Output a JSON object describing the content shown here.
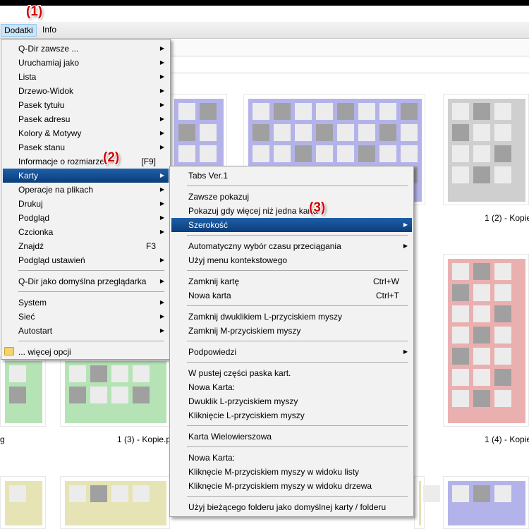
{
  "menubar": {
    "items": [
      {
        "label": "Dodatki",
        "active": true
      },
      {
        "label": "Info",
        "active": false
      }
    ]
  },
  "callouts": [
    "(1)",
    "(2)",
    "(3)"
  ],
  "main_menu": {
    "items": [
      {
        "label": "Q-Dir zawsze ...",
        "submenu": true
      },
      {
        "label": "Uruchamiaj jako",
        "submenu": true
      },
      {
        "label": "Lista",
        "submenu": true
      },
      {
        "label": "Drzewo-Widok",
        "submenu": true
      },
      {
        "label": "Pasek tytułu",
        "submenu": true
      },
      {
        "label": "Pasek adresu",
        "submenu": true
      },
      {
        "label": "Kolory & Motywy",
        "submenu": true
      },
      {
        "label": "Pasek stanu",
        "submenu": true
      },
      {
        "label": "Informacje o rozmiarze",
        "shortcut": "[F9]"
      },
      {
        "label": "Karty",
        "submenu": true,
        "highlighted": true
      },
      {
        "label": "Operacje na plikach",
        "submenu": true
      },
      {
        "label": "Drukuj",
        "submenu": true
      },
      {
        "label": "Podgląd",
        "submenu": true
      },
      {
        "label": "Czcionka",
        "submenu": true
      },
      {
        "label": "Znajdź",
        "shortcut": "F3"
      },
      {
        "label": "Podgląd ustawień",
        "submenu": true
      },
      {
        "separator": true
      },
      {
        "label": "Q-Dir jako domyślna przeglądarka",
        "submenu": true
      },
      {
        "separator": true
      },
      {
        "label": "System",
        "submenu": true
      },
      {
        "label": "Sieć",
        "submenu": true
      },
      {
        "label": "Autostart",
        "submenu": true
      },
      {
        "separator": true
      },
      {
        "label": "... więcej opcji",
        "icon": "folder-icon"
      }
    ]
  },
  "karty_menu": {
    "items": [
      {
        "label": "Tabs Ver.1"
      },
      {
        "separator": true
      },
      {
        "label": "Zawsze pokazuj"
      },
      {
        "label": "Pokazuj gdy więcej niż jedna karta"
      },
      {
        "label": "Szerokość",
        "submenu": true,
        "highlighted": true
      },
      {
        "separator": true
      },
      {
        "label": "Automatyczny wybór czasu przeciągania",
        "submenu": true
      },
      {
        "label": "Użyj menu kontekstowego"
      },
      {
        "separator": true
      },
      {
        "label": "Zamknij kartę",
        "shortcut": "Ctrl+W"
      },
      {
        "label": "Nowa karta",
        "shortcut": "Ctrl+T"
      },
      {
        "separator": true
      },
      {
        "label": "Zamknij dwuklikiem L-przyciskiem myszy"
      },
      {
        "label": "Zamknij M-przyciskiem myszy"
      },
      {
        "separator": true
      },
      {
        "label": "Podpowiedzi",
        "submenu": true
      },
      {
        "separator": true
      },
      {
        "label": "W pustej części paska kart."
      },
      {
        "label": "Nowa Karta:"
      },
      {
        "label": "Dwuklik L-przyciskiem myszy"
      },
      {
        "label": "Kliknięcie L-przyciskiem myszy"
      },
      {
        "separator": true
      },
      {
        "label": "Karta Wielowierszowa"
      },
      {
        "separator": true
      },
      {
        "label": "Nowa Karta:"
      },
      {
        "label": "Kliknęcie M-przyciskiem myszy w widoku listy"
      },
      {
        "label": "Kliknęcie M-przyciskiem myszy w widoku drzewa"
      },
      {
        "separator": true
      },
      {
        "label": "Użyj bieżącego folderu jako domyślnej karty / folderu"
      }
    ]
  },
  "thumb_colors": {
    "blue": "#b3b3ea",
    "gray": "#cfcfcf",
    "red": "#eab0b0",
    "green": "#b5e3b5",
    "yellow": "#e6e3b5"
  },
  "captions": {
    "top_right": "1 (2) - Kopie",
    "mid_left": "g",
    "mid_center": "1 (3) - Kopie.p",
    "mid_right": "1 (4) - Kopie"
  }
}
